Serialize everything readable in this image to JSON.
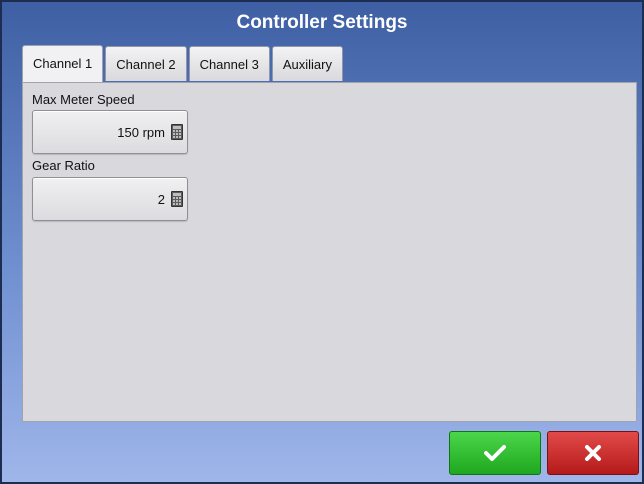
{
  "window": {
    "title": "Controller Settings"
  },
  "tabs": [
    {
      "label": "Channel 1",
      "active": true
    },
    {
      "label": "Channel 2",
      "active": false
    },
    {
      "label": "Channel 3",
      "active": false
    },
    {
      "label": "Auxiliary",
      "active": false
    }
  ],
  "fields": {
    "max_meter_speed": {
      "label": "Max Meter Speed",
      "value": "150 rpm",
      "icon": "calculator-icon"
    },
    "gear_ratio": {
      "label": "Gear Ratio",
      "value": "2",
      "icon": "calculator-icon"
    }
  },
  "actions": {
    "ok_icon": "checkmark-icon",
    "cancel_icon": "x-close-icon",
    "ok_color": "#2dbb2d",
    "cancel_color": "#c62525"
  }
}
